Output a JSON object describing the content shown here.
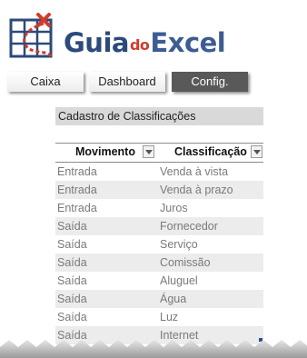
{
  "logo": {
    "guia": "Guia",
    "do": "do",
    "excel": "Excel"
  },
  "nav": {
    "buttons": [
      {
        "label": "Caixa"
      },
      {
        "label": "Dashboard"
      },
      {
        "label": "Config."
      }
    ]
  },
  "sheet": {
    "title": "Cadastro de Classificações",
    "columns": [
      "Movimento",
      "Classificação"
    ],
    "rows": [
      {
        "movimento": "Entrada",
        "classificacao": "Venda à vista"
      },
      {
        "movimento": "Entrada",
        "classificacao": "Venda à prazo"
      },
      {
        "movimento": "Entrada",
        "classificacao": "Juros"
      },
      {
        "movimento": "Saída",
        "classificacao": "Fornecedor"
      },
      {
        "movimento": "Saída",
        "classificacao": "Serviço"
      },
      {
        "movimento": "Saída",
        "classificacao": "Comissão"
      },
      {
        "movimento": "Saída",
        "classificacao": "Aluguel"
      },
      {
        "movimento": "Saída",
        "classificacao": "Água"
      },
      {
        "movimento": "Saída",
        "classificacao": "Luz"
      },
      {
        "movimento": "Saída",
        "classificacao": "Internet"
      }
    ]
  },
  "colors": {
    "brand_blue": "#2c4a7a",
    "brand_red": "#d23a2a",
    "active_tab": "#595959",
    "header_band": "#d9d9d9",
    "row_band": "#ececec"
  }
}
